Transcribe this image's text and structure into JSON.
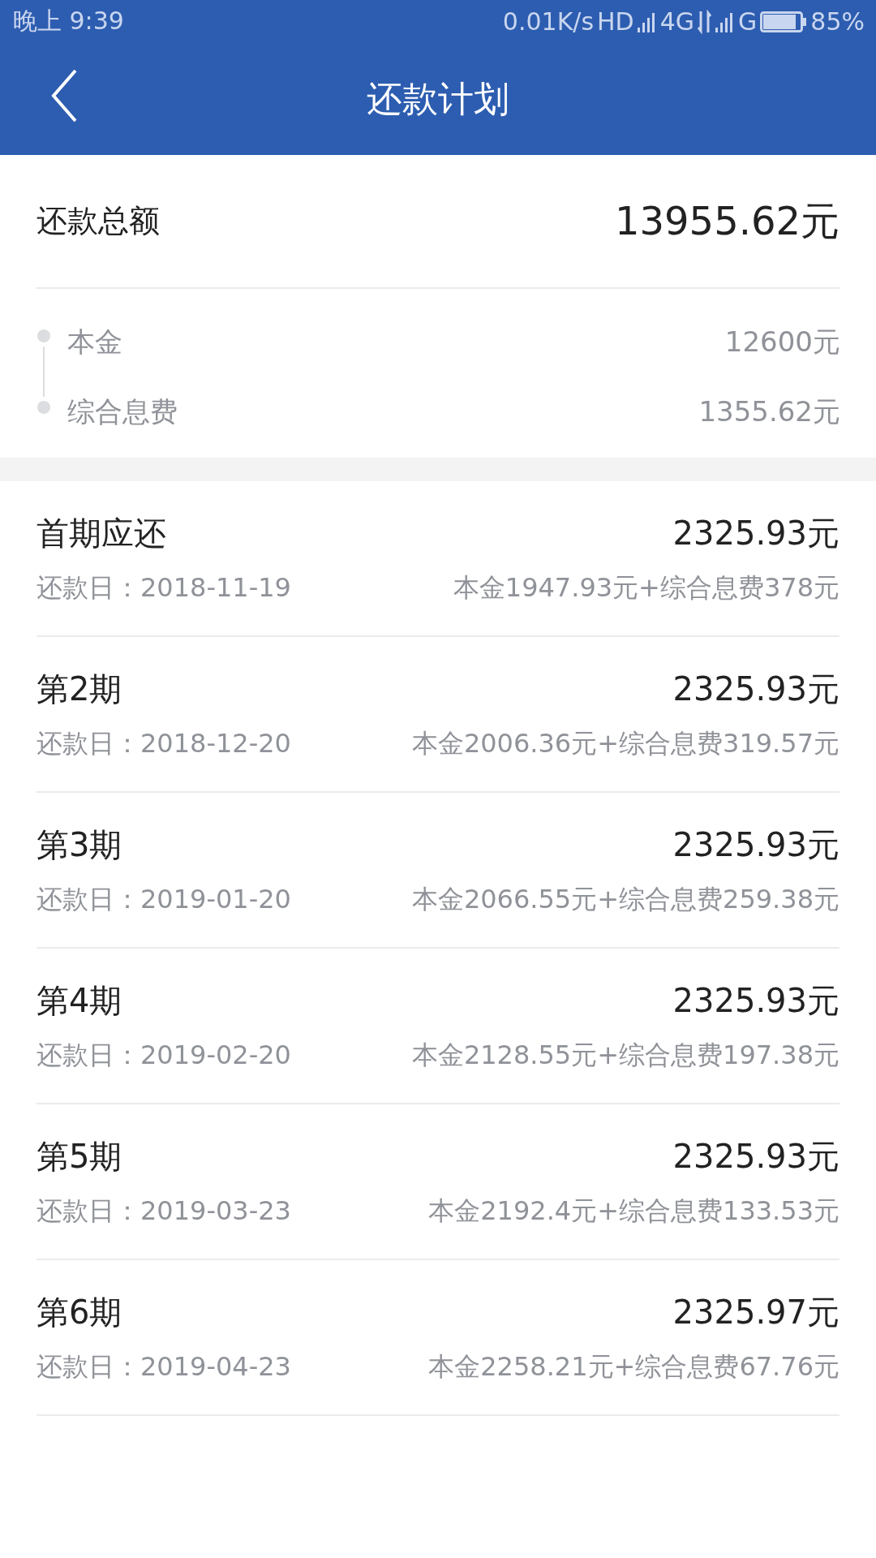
{
  "status_bar": {
    "time": "晚上 9:39",
    "speed": "0.01K/s",
    "hd": "HD",
    "network_1": "4G",
    "network_2": "G",
    "battery": "85%"
  },
  "header": {
    "title": "还款计划"
  },
  "summary": {
    "label": "还款总额",
    "amount": "13955.62元",
    "breakdown": [
      {
        "label": "本金",
        "amount": "12600元"
      },
      {
        "label": "综合息费",
        "amount": "1355.62元"
      }
    ]
  },
  "installments": [
    {
      "title": "首期应还",
      "amount": "2325.93元",
      "date": "还款日：2018-11-19",
      "detail": "本金1947.93元+综合息费378元"
    },
    {
      "title": "第2期",
      "amount": "2325.93元",
      "date": "还款日：2018-12-20",
      "detail": "本金2006.36元+综合息费319.57元"
    },
    {
      "title": "第3期",
      "amount": "2325.93元",
      "date": "还款日：2019-01-20",
      "detail": "本金2066.55元+综合息费259.38元"
    },
    {
      "title": "第4期",
      "amount": "2325.93元",
      "date": "还款日：2019-02-20",
      "detail": "本金2128.55元+综合息费197.38元"
    },
    {
      "title": "第5期",
      "amount": "2325.93元",
      "date": "还款日：2019-03-23",
      "detail": "本金2192.4元+综合息费133.53元"
    },
    {
      "title": "第6期",
      "amount": "2325.97元",
      "date": "还款日：2019-04-23",
      "detail": "本金2258.21元+综合息费67.76元"
    }
  ]
}
